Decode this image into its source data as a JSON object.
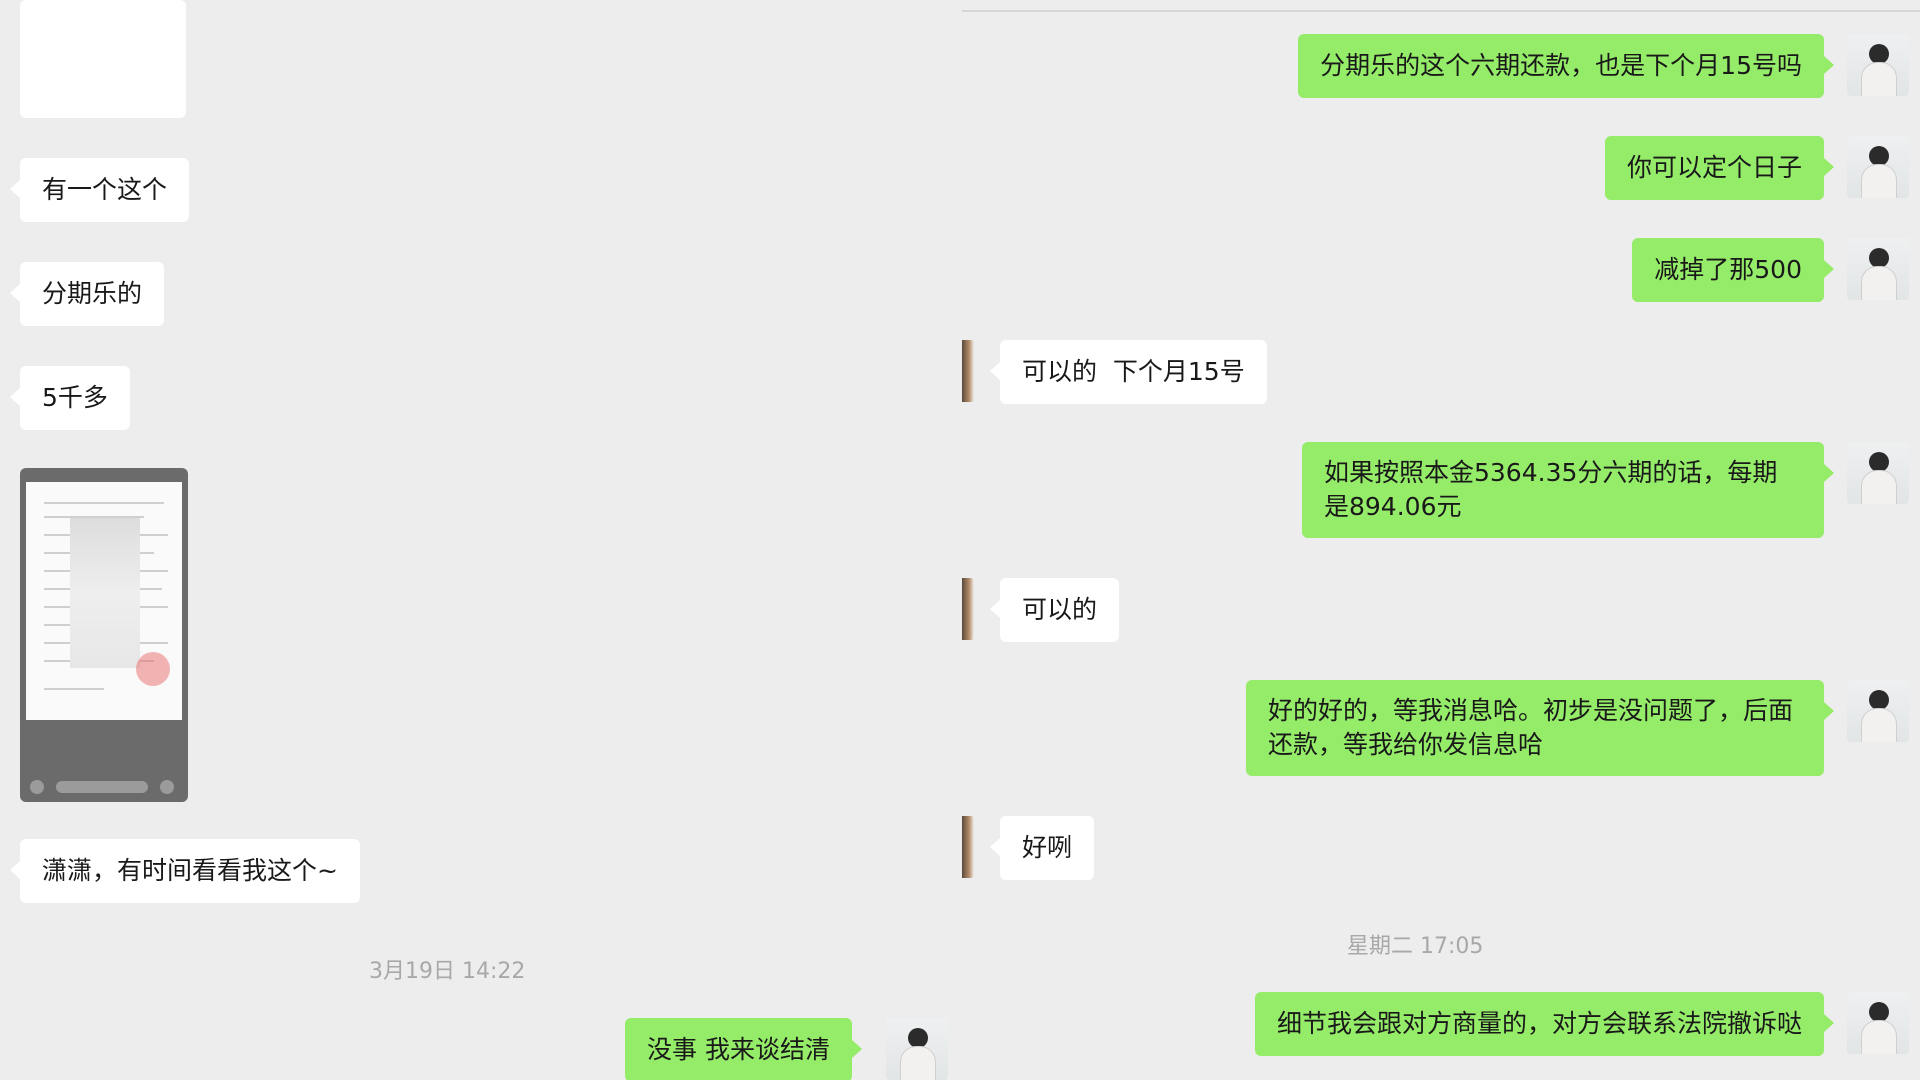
{
  "left": {
    "messages": [
      {
        "text": "有一个这个"
      },
      {
        "text": "分期乐的"
      },
      {
        "text": "5千多"
      },
      {
        "text": "潇潇，有时间看看我这个~"
      }
    ],
    "timestamp": "3月19日 14:22",
    "outgoing": "没事 我来谈结清"
  },
  "right": {
    "messages": [
      {
        "text": "分期乐的这个六期还款，也是下个月15号吗"
      },
      {
        "text": "你可以定个日子"
      },
      {
        "text": "减掉了那500"
      },
      {
        "text": "可以的  下个月15号"
      },
      {
        "text": "如果按照本金5364.35分六期的话，每期是894.06元"
      },
      {
        "text": "可以的"
      },
      {
        "text": "好的好的，等我消息哈。初步是没问题了，后面还款，等我给你发信息哈"
      },
      {
        "text": "好咧"
      },
      {
        "text": "细节我会跟对方商量的，对方会联系法院撤诉哒"
      }
    ],
    "timestamp": "星期二 17:05"
  },
  "colors": {
    "background": "#ededed",
    "incoming_bubble": "#ffffff",
    "outgoing_bubble": "#95ec69",
    "timestamp": "#a8a8a8"
  }
}
